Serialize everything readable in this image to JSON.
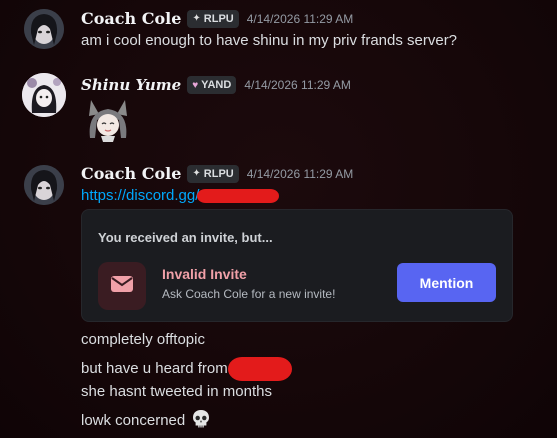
{
  "messages": [
    {
      "author": "Coach Cole",
      "tag": "RLPU",
      "tag_icon": "sparkle-icon",
      "timestamp": "4/14/2026 11:29 AM",
      "lines": [
        "am i cool enough to have shinu in my priv frands server?"
      ]
    },
    {
      "author": "Shinu Yume",
      "tag": "YAND",
      "tag_icon": "heart-icon",
      "timestamp": "4/14/2026 11:29 AM",
      "sticker": "anime-girl-emoji"
    },
    {
      "author": "Coach Cole",
      "tag": "RLPU",
      "tag_icon": "sparkle-icon",
      "timestamp": "4/14/2026 11:29 AM",
      "link_prefix": "https://discord.gg/",
      "invite_card": {
        "title": "You received an invite, but...",
        "name": "Invalid Invite",
        "subtitle": "Ask Coach Cole for a new invite!",
        "button_label": "Mention"
      },
      "lines": [
        "completely offtopic",
        "but have u heard from",
        "she hasnt tweeted in months",
        "lowk concerned"
      ]
    }
  ],
  "colors": {
    "background": "#160709",
    "link": "#00a8fc",
    "redaction": "#e31b1b",
    "button": "#5865f2",
    "invalid_text": "#f0a0a8"
  }
}
